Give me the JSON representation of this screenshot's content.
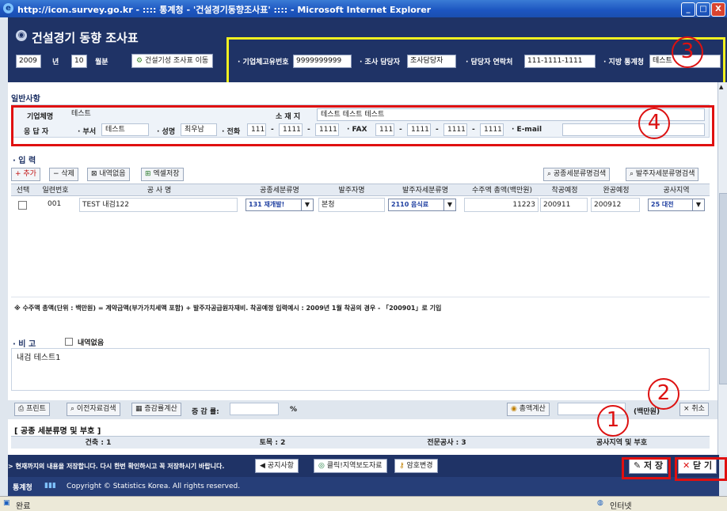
{
  "window": {
    "title": "http://icon.survey.go.kr - :::: 통계청 - '건설경기동향조사표' :::: - Microsoft Internet Explorer",
    "min": "_",
    "max": "□",
    "close": "X"
  },
  "header": {
    "title": "건설경기 동향 조사표",
    "year": "2009",
    "year_unit": "년",
    "month": "10",
    "month_unit": "월분",
    "move_button": "건설기성 조사표 이동",
    "biz_no_label": "· 기업체고유번호",
    "biz_no": "9999999999",
    "person_label": "· 조사 담당자",
    "person": "조사담당자",
    "contact_label": "· 담당자 연락처",
    "contact": "111-1111-1111",
    "office_label": "· 지방 통계청",
    "office": "테스트"
  },
  "general": {
    "title": "일반사항",
    "company_label": "기업체명",
    "company": "테스트",
    "location_label": "소 재 지",
    "location": "테스트 테스트 테스트",
    "respondent_label": "응 답 자",
    "dept_label": "· 부서",
    "dept": "테스트",
    "name_label": "· 성명",
    "name": "최우남",
    "phone_label": "· 전화",
    "phone1": "111",
    "phone2": "1111",
    "phone3": "1111",
    "fax_label": "· FAX",
    "fax1": "111",
    "fax2": "1111",
    "fax3": "1111",
    "email_label": "· E-mail",
    "dash": "-"
  },
  "input": {
    "title": "· 입 력",
    "add": "+ 추가",
    "delete": "− 삭제",
    "none": "내역없음",
    "excel": "엑셀저장",
    "search_type": "공종세분류명검색",
    "search_client": "발주자세분류명검색",
    "columns": [
      "선택",
      "일련번호",
      "공 사 명",
      "공종세분류명",
      "발주자명",
      "발주자세분류명",
      "수주액 총액(백만원)",
      "착공예정",
      "완공예정",
      "공사지역"
    ],
    "row": {
      "serial": "001",
      "name": "TEST 내검122",
      "type": "131 재개발!",
      "client": "본청",
      "client_type": "2110 음식료",
      "amount": "11223",
      "start": "200911",
      "end": "200912",
      "region": "25 대전"
    },
    "note": "※ 수주액 총액(단위 : 백만원) = 계약금액(부가가치세액 포함) + 발주자공급원자재비. 착공예정 입력예시 : 2009년 1월 착공의 경우 - 「200901」로 기입"
  },
  "remarks": {
    "title": "· 비 고",
    "none": "내역없음",
    "text": "내검 테스트1"
  },
  "bottom": {
    "print": "프린트",
    "prev_search": "이전자료검색",
    "calc_rate": "증감률계산",
    "rate_label": "증 감 률:",
    "percent": "%",
    "total_calc": "총액계산",
    "unit": "(백만원)",
    "cancel": "× 취소"
  },
  "category": {
    "title": "[ 공종 세분류명 및 부호 ]",
    "cols": [
      "건축 : 1",
      "토목 : 2",
      "전문공사 : 3",
      "공사지역 및 부호"
    ]
  },
  "footer": {
    "notice_text": "> 현재까지의 내용을 저장합니다. 다시 한번 확인하시고 꼭 저장하시기 바랍니다.",
    "notice_btn": "공지사항",
    "region_btn": "클릭!지역보도자료",
    "pw_btn": "암호변경",
    "save": "저 장",
    "close": "닫 기",
    "logo": "통계청",
    "copyright": "Copyright © Statistics Korea. All rights reserved."
  },
  "status": {
    "done": "완료",
    "zone": "인터넷"
  },
  "annotations": [
    "1",
    "2",
    "3",
    "4"
  ]
}
